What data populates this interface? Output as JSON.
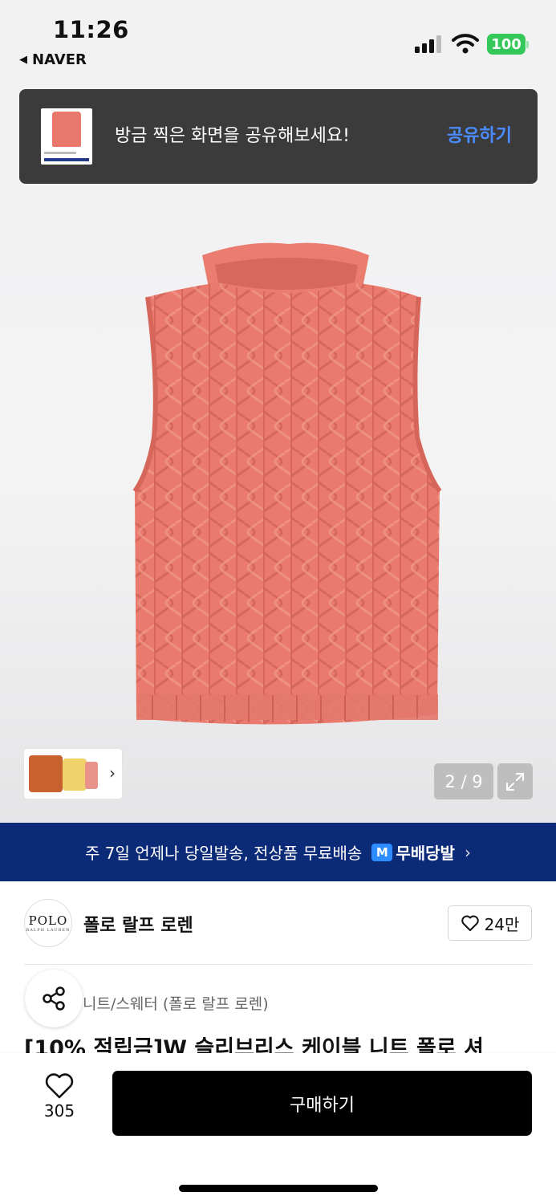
{
  "status_bar": {
    "time": "11:26",
    "back_app": "NAVER",
    "battery": "100"
  },
  "share_toast": {
    "message": "방금 찍은 화면을 공유해보세요!",
    "action": "공유하기"
  },
  "gallery": {
    "counter": "2 / 9"
  },
  "shipping_banner": {
    "text": "주 7일 언제나 당일발송, 전상품 무료배송",
    "badge_icon": "M",
    "badge_label": "무배당발"
  },
  "brand": {
    "logo_line1": "POLO",
    "logo_line2": "RALPH LAUREN",
    "name": "폴로 랄프 로렌",
    "likes": "24만"
  },
  "product": {
    "category": "니트/스웨터 (폴로 랄프 로렌)",
    "title": "[10% 적립금]W 슬리브리스 케이블 니트 폴로 셔"
  },
  "bottom_bar": {
    "wish_count": "305",
    "buy_label": "구매하기"
  },
  "colors": {
    "banner_bg": "#0b2a78",
    "toast_bg": "#3b3b3c",
    "toast_action": "#4a8cff",
    "product_coral": "#e8786b",
    "battery_green": "#34c759"
  }
}
